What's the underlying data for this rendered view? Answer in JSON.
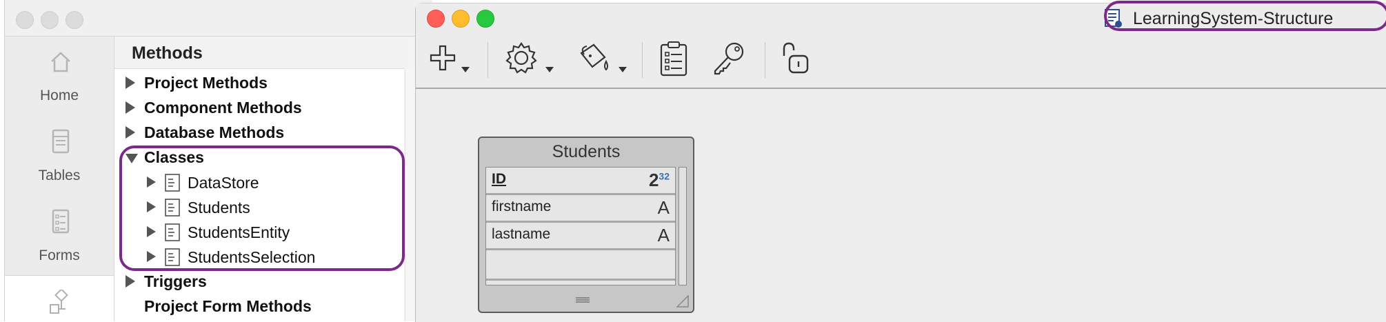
{
  "explorer": {
    "sidebar": {
      "items": [
        {
          "label": "Home",
          "icon": "home-icon"
        },
        {
          "label": "Tables",
          "icon": "tables-icon"
        },
        {
          "label": "Forms",
          "icon": "forms-icon"
        },
        {
          "label": "",
          "icon": "methods-icon"
        }
      ]
    },
    "methods": {
      "title": "Methods",
      "tree": [
        {
          "label": "Project Methods",
          "expanded": false
        },
        {
          "label": "Component Methods",
          "expanded": false
        },
        {
          "label": "Database Methods",
          "expanded": false
        },
        {
          "label": "Classes",
          "expanded": true,
          "children": [
            "DataStore",
            "Students",
            "StudentsEntity",
            "StudentsSelection"
          ]
        },
        {
          "label": "Triggers",
          "expanded": false
        },
        {
          "label": "Project Form Methods",
          "expanded": false
        }
      ]
    }
  },
  "structure_window": {
    "title": "LearningSystem-Structure",
    "toolbar": {
      "buttons": [
        "add-icon",
        "gear-icon",
        "paint-bucket-icon",
        "clipboard-icon",
        "key-icon",
        "unlock-icon"
      ]
    },
    "table": {
      "name": "Students",
      "fields": [
        {
          "name": "ID",
          "type_icon": "longint-icon",
          "type_text": "2",
          "type_sup": "32",
          "primary_key": true
        },
        {
          "name": "firstname",
          "type_icon": "alpha-icon",
          "type_text": "A"
        },
        {
          "name": "lastname",
          "type_icon": "alpha-icon",
          "type_text": "A"
        }
      ]
    }
  },
  "colors": {
    "highlight": "#7b2a8a",
    "traffic_red": "#ff5f57",
    "traffic_yellow": "#febc2e",
    "traffic_green": "#28c840"
  }
}
